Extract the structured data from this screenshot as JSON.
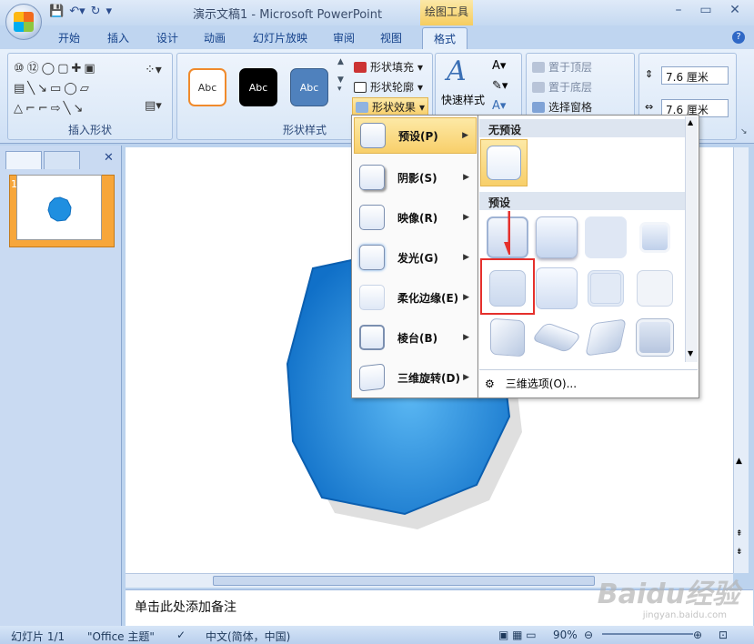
{
  "window": {
    "title": "演示文稿1 - Microsoft PowerPoint",
    "context_tab_title": "绘图工具",
    "controls": [
      "minimize",
      "maximize",
      "close"
    ]
  },
  "qat": {
    "icons": [
      "save-icon",
      "undo-icon",
      "redo-icon",
      "customize-icon"
    ]
  },
  "tabs": [
    {
      "label": "开始"
    },
    {
      "label": "插入"
    },
    {
      "label": "设计"
    },
    {
      "label": "动画"
    },
    {
      "label": "幻灯片放映"
    },
    {
      "label": "审阅"
    },
    {
      "label": "视图"
    },
    {
      "label": "格式",
      "active": true
    }
  ],
  "ribbon": {
    "insert_shapes_label": "插入形状",
    "shape_styles_label": "形状样式",
    "style_samples": [
      "Abc",
      "Abc",
      "Abc"
    ],
    "shape_fill": "形状填充",
    "shape_outline": "形状轮廓",
    "shape_effects": "形状效果",
    "quick_styles": "快速样式",
    "bring_to_front": "置于顶层",
    "send_to_back": "置于底层",
    "selection_pane": "选择窗格",
    "height_value": "7.6 厘米",
    "width_value": "7.6 厘米"
  },
  "effects_menu": {
    "items": [
      {
        "label": "预设(P)",
        "active": true
      },
      {
        "label": "阴影(S)"
      },
      {
        "label": "映像(R)"
      },
      {
        "label": "发光(G)"
      },
      {
        "label": "柔化边缘(E)"
      },
      {
        "label": "棱台(B)"
      },
      {
        "label": "三维旋转(D)"
      }
    ]
  },
  "preset_submenu": {
    "no_preset_header": "无预设",
    "preset_header": "预设",
    "footer": "三维选项(O)...",
    "presets_count": 12,
    "selected_index": 4
  },
  "slide_panel": {
    "slide_number": "1"
  },
  "notes_placeholder": "单击此处添加备注",
  "status": {
    "slide_info": "幻灯片 1/1",
    "theme": "\"Office 主题\"",
    "language": "中文(简体，中国)",
    "zoom": "90%"
  },
  "colors": {
    "accent_orange": "#f7a63a",
    "shape_blue": "#1f8fe0",
    "highlight_red": "#e5302c"
  },
  "watermark": "Baidu经验",
  "watermark_sub": "jingyan.baidu.com"
}
